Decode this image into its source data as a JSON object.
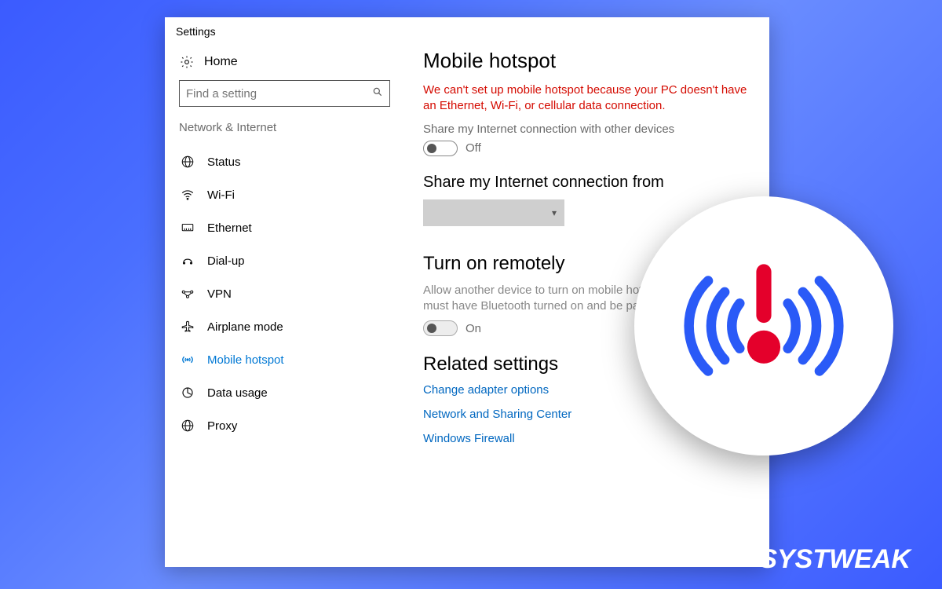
{
  "window": {
    "title": "Settings"
  },
  "sidebar": {
    "home": "Home",
    "search_placeholder": "Find a setting",
    "category": "Network & Internet",
    "items": [
      {
        "label": "Status",
        "icon": "status"
      },
      {
        "label": "Wi-Fi",
        "icon": "wifi"
      },
      {
        "label": "Ethernet",
        "icon": "ethernet"
      },
      {
        "label": "Dial-up",
        "icon": "dialup"
      },
      {
        "label": "VPN",
        "icon": "vpn"
      },
      {
        "label": "Airplane mode",
        "icon": "airplane"
      },
      {
        "label": "Mobile hotspot",
        "icon": "hotspot",
        "active": true
      },
      {
        "label": "Data usage",
        "icon": "datausage"
      },
      {
        "label": "Proxy",
        "icon": "proxy"
      }
    ]
  },
  "main": {
    "title": "Mobile hotspot",
    "error": "We can't set up mobile hotspot because your PC doesn't have an Ethernet, Wi-Fi, or cellular data connection.",
    "share_label": "Share my Internet connection with other devices",
    "share_toggle": "Off",
    "share_from_label": "Share my Internet connection from",
    "share_from_value": "",
    "remote_title": "Turn on remotely",
    "remote_desc": "Allow another device to turn on mobile hotspot. Both devices must have Bluetooth turned on and be paired.",
    "remote_toggle": "On",
    "related_title": "Related settings",
    "links": [
      "Change adapter options",
      "Network and Sharing Center",
      "Windows Firewall"
    ]
  },
  "brand": "SYSTWEAK"
}
